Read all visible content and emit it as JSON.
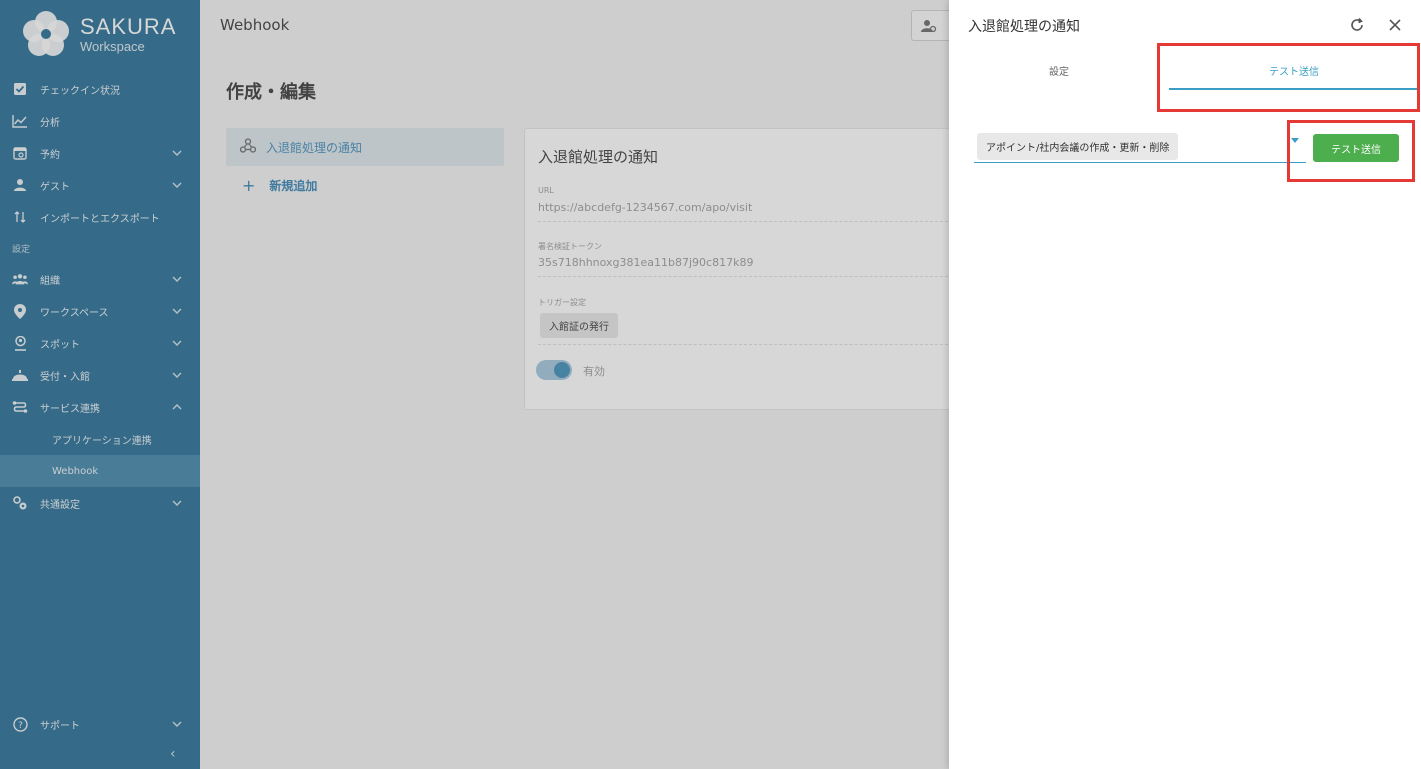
{
  "app": {
    "brand": "SAKURA",
    "brand_sub": "Workspace"
  },
  "sidebar": {
    "items": [
      {
        "label": "チェックイン状況",
        "icon": "check-square-icon"
      },
      {
        "label": "分析",
        "icon": "line-chart-icon"
      },
      {
        "label": "予約",
        "icon": "calendar-icon",
        "expandable": true
      },
      {
        "label": "ゲスト",
        "icon": "person-icon",
        "expandable": true
      },
      {
        "label": "インポートとエクスポート",
        "icon": "import-export-icon"
      }
    ],
    "section_label": "設定",
    "settings_items": [
      {
        "label": "組織",
        "icon": "group-icon",
        "expandable": true
      },
      {
        "label": "ワークスペース",
        "icon": "location-pin-icon",
        "expandable": true
      },
      {
        "label": "スポット",
        "icon": "person-pin-icon",
        "expandable": true
      },
      {
        "label": "受付・入館",
        "icon": "reception-bell-icon",
        "expandable": true
      },
      {
        "label": "サービス連携",
        "icon": "route-icon",
        "expandable": true,
        "expanded": true
      }
    ],
    "sub_items": [
      {
        "label": "アプリケーション連携",
        "active": false
      },
      {
        "label": "Webhook",
        "active": true
      }
    ],
    "common_settings": {
      "label": "共通設定",
      "icon": "gears-icon"
    },
    "support": {
      "label": "サポート",
      "icon": "help-circle-icon"
    },
    "collapse_glyph": "‹"
  },
  "main": {
    "topbar_title": "Webhook",
    "page_title": "作成・編集",
    "hook_list": [
      {
        "label": "入退館処理の通知",
        "icon": "webhook-icon"
      }
    ],
    "add_label": "新規追加",
    "card": {
      "title": "入退館処理の通知",
      "url_label": "URL",
      "url_value": "https://abcdefg-1234567.com/apo/visit",
      "token_label": "署名検証トークン",
      "token_value": "35s718hhnoxg381ea11b87j90c817k89",
      "trigger_label": "トリガー設定",
      "trigger_chip": "入館証の発行",
      "enabled_label": "有効",
      "enabled": true
    }
  },
  "drawer": {
    "title": "入退館処理の通知",
    "tabs": [
      {
        "label": "設定",
        "active": false
      },
      {
        "label": "テスト送信",
        "active": true
      }
    ],
    "event_selected": "アポイント/社内会議の作成・更新・削除",
    "send_label": "テスト送信"
  },
  "colors": {
    "sidebar": "#1f6a93",
    "accent": "#3a9ec4",
    "send_button": "#4cae4c",
    "highlight": "#e53935"
  }
}
